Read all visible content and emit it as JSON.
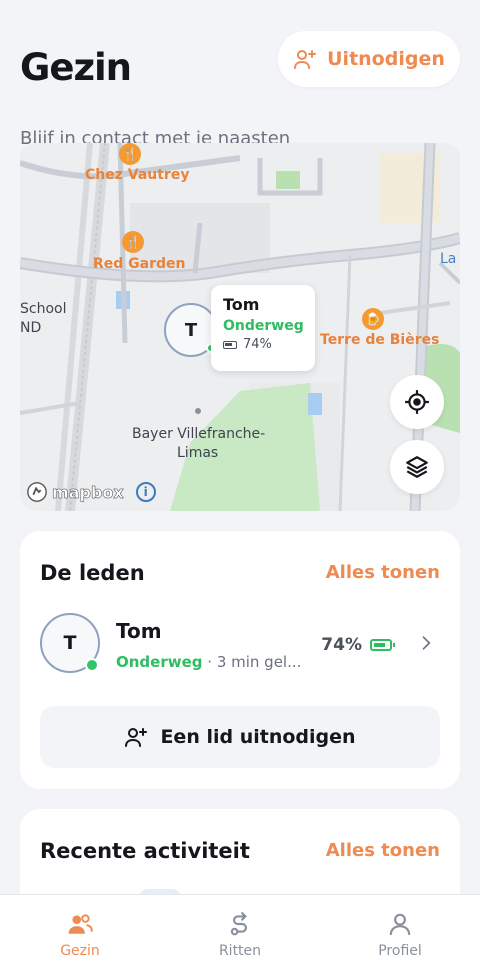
{
  "header": {
    "title": "Gezin",
    "subtitle": "Blijf in contact met je naasten",
    "invite_label": "Uitnodigen"
  },
  "map": {
    "labels": {
      "chez_vautrey": "Chez Vautrey",
      "red_garden": "Red Garden",
      "school": "School",
      "school_suffix": "ND",
      "terre_de_bieres": "Terre de Bières",
      "bayer_line1": "Bayer Villefranche-",
      "bayer_line2": "Limas",
      "la": "La"
    },
    "attribution": "mapbox",
    "marker": {
      "initial": "T",
      "name": "Tom",
      "status": "Onderweg",
      "battery": "74%"
    }
  },
  "members": {
    "title": "De leden",
    "show_all": "Alles tonen",
    "items": [
      {
        "initial": "T",
        "name": "Tom",
        "status": "Onderweg",
        "detail": " · 3 min gel...",
        "battery": "74%"
      }
    ],
    "add_label": "Een lid uitnodigen"
  },
  "activity": {
    "title": "Recente activiteit",
    "show_all": "Alles tonen"
  },
  "tabs": [
    {
      "label": "Gezin",
      "active": true
    },
    {
      "label": "Ritten",
      "active": false
    },
    {
      "label": "Profiel",
      "active": false
    }
  ],
  "colors": {
    "accent": "#ef8a52",
    "online": "#2fbd62",
    "background": "#f3f4f7"
  }
}
